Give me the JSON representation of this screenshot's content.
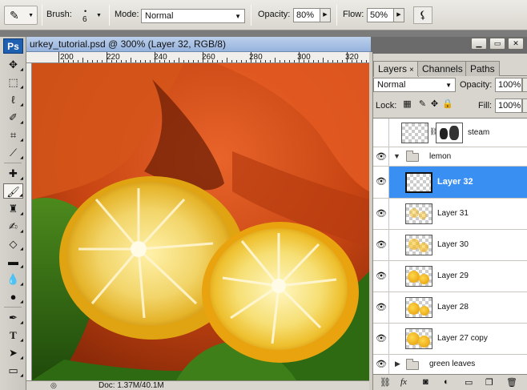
{
  "options_bar": {
    "brush_label": "Brush:",
    "brush_size": "6",
    "mode_label": "Mode:",
    "mode_value": "Normal",
    "opacity_label": "Opacity:",
    "opacity_value": "80%",
    "flow_label": "Flow:",
    "flow_value": "50%"
  },
  "toolbox": {
    "logo": "Ps"
  },
  "document": {
    "title": "urkey_tutorial.psd @ 300% (Layer 32, RGB/8)",
    "ruler_labels": [
      "200",
      "220",
      "240",
      "260",
      "280",
      "300",
      "320"
    ],
    "status_doc": "Doc: 1.37M/40.1M"
  },
  "layers_panel": {
    "tabs": [
      {
        "label": "Layers",
        "close": "×"
      },
      {
        "label": "Channels"
      },
      {
        "label": "Paths"
      }
    ],
    "blend_mode": "Normal",
    "opacity_label": "Opacity:",
    "opacity_value": "100%",
    "lock_label": "Lock:",
    "fill_label": "Fill:",
    "fill_value": "100%",
    "layers": [
      {
        "name": "steam",
        "type": "layer-with-mask",
        "visible": false
      },
      {
        "name": "lemon",
        "type": "group-open",
        "visible": true
      },
      {
        "name": "Layer 32",
        "type": "layer",
        "visible": true,
        "selected": true
      },
      {
        "name": "Layer 31",
        "type": "layer",
        "visible": true
      },
      {
        "name": "Layer 30",
        "type": "layer",
        "visible": true
      },
      {
        "name": "Layer 29",
        "type": "layer",
        "visible": true
      },
      {
        "name": "Layer 28",
        "type": "layer",
        "visible": true
      },
      {
        "name": "Layer 27 copy",
        "type": "layer",
        "visible": true
      },
      {
        "name": "green leaves",
        "type": "group-closed",
        "visible": true
      }
    ]
  },
  "colors": {
    "selection": "#3a8ff2",
    "panel_bg": "#d7d5cd",
    "title_bar": "#96b3dd"
  }
}
